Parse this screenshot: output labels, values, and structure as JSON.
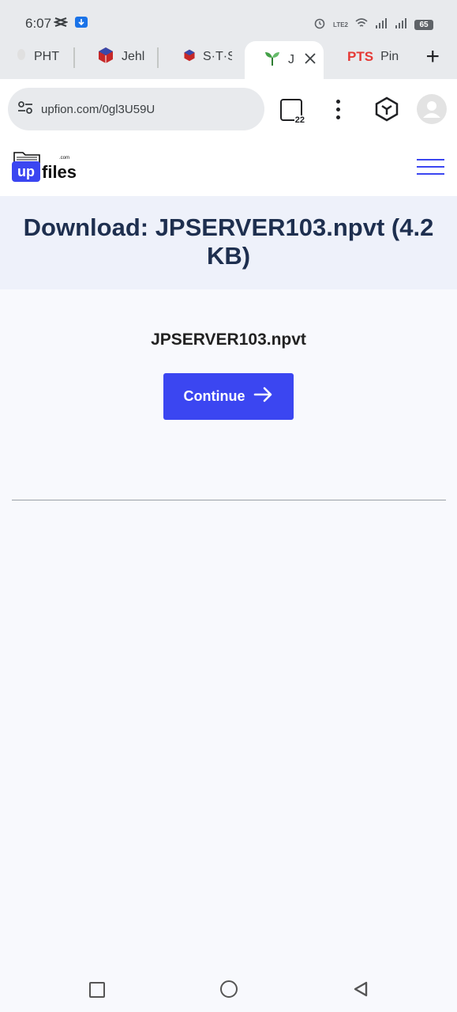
{
  "status_bar": {
    "time": "6:07",
    "battery": "65",
    "network": "LTE2"
  },
  "tabs": [
    {
      "label": "PHT",
      "active": false
    },
    {
      "label": "Jehl",
      "active": false
    },
    {
      "label": "S·T·S",
      "active": false
    },
    {
      "label": "J",
      "active": true
    },
    {
      "label": "Pino",
      "active": false
    }
  ],
  "toolbar": {
    "url": "upfion.com/0gl3U59U",
    "tab_count": "22"
  },
  "site": {
    "logo_up": "up",
    "logo_files": "files",
    "logo_com": ".com"
  },
  "banner": {
    "title": "Download: JPSERVER103.npvt (4.2 KB)"
  },
  "main": {
    "filename": "JPSERVER103.npvt",
    "continue_label": "Continue"
  },
  "colors": {
    "accent": "#3b46f1",
    "banner_bg": "#eef1fa",
    "title": "#1e2f4f"
  }
}
